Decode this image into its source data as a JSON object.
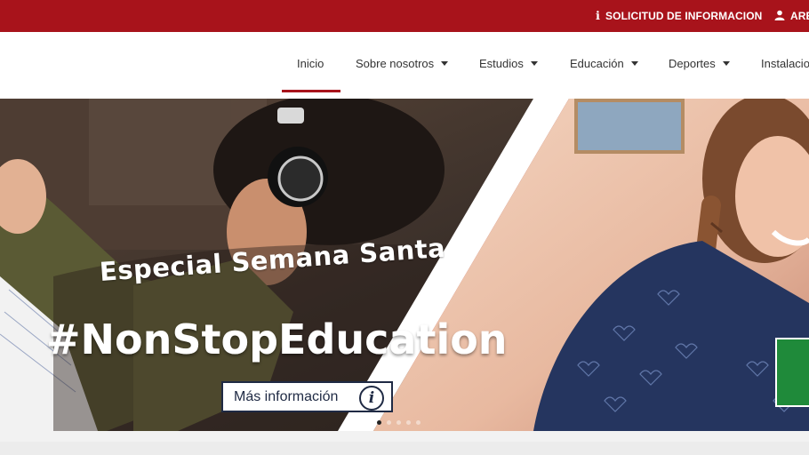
{
  "topbar": {
    "request_info_icon": "info-icon",
    "request_info_label": "SOLICITUD DE INFORMACION",
    "area_icon": "user-icon",
    "area_label": "ARE",
    "color": "#a8131b"
  },
  "nav": {
    "items": [
      {
        "label": "Inicio",
        "has_caret": false,
        "active": true
      },
      {
        "label": "Sobre nosotros",
        "has_caret": true
      },
      {
        "label": "Estudios",
        "has_caret": true
      },
      {
        "label": "Educación",
        "has_caret": true
      },
      {
        "label": "Deportes",
        "has_caret": true
      },
      {
        "label": "Instalacio",
        "has_caret": false
      }
    ]
  },
  "hero": {
    "subtitle": "Especial Semana Santa",
    "title": "#NonStopEducation",
    "button_label": "Más información",
    "button_icon": "info-circle-icon",
    "slide_count": 5,
    "active_slide": 1
  }
}
